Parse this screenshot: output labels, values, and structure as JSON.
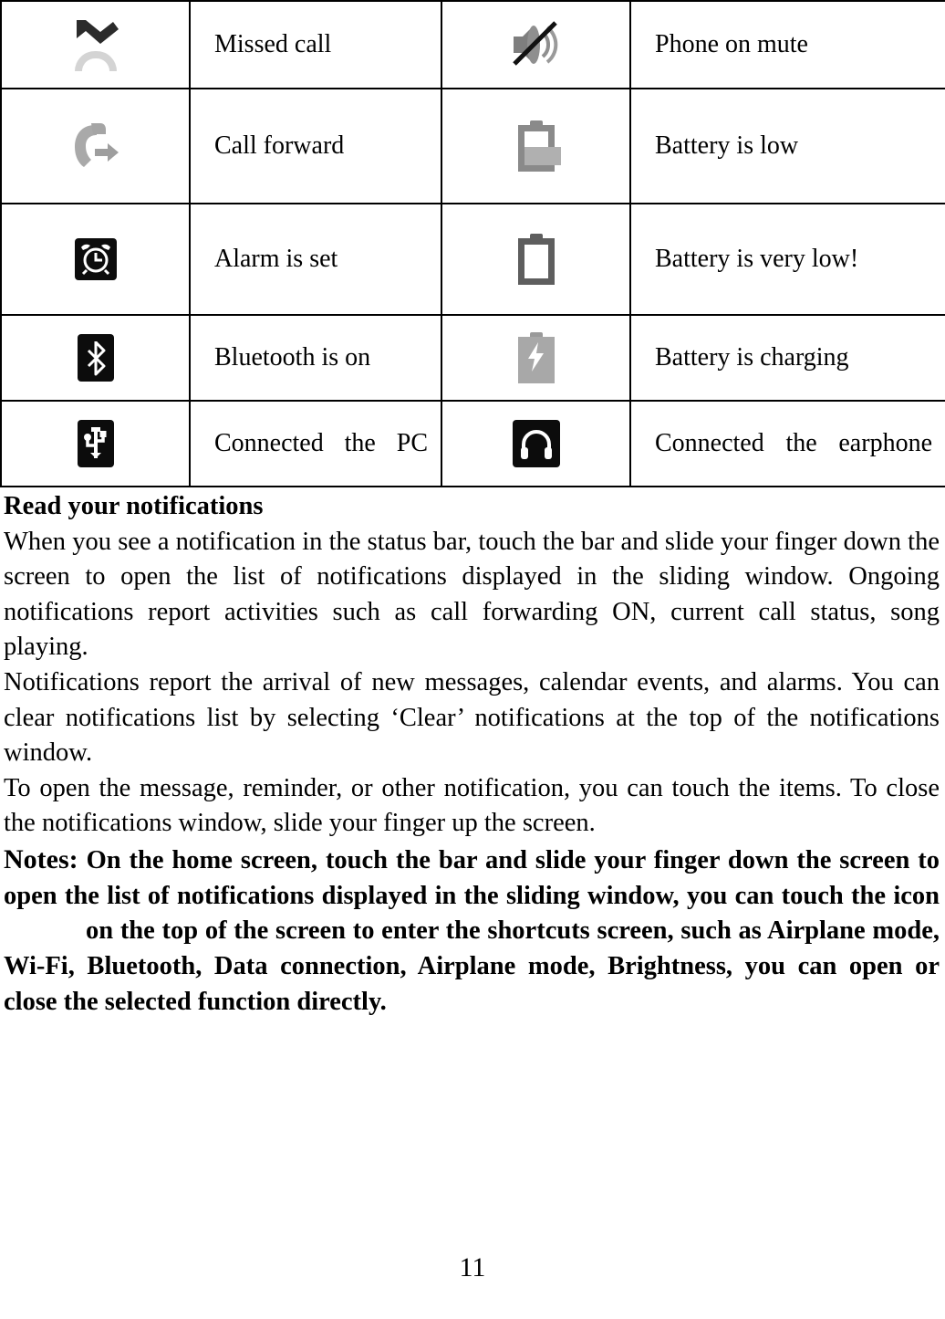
{
  "status_icon_table": {
    "rows": [
      {
        "left_icon": "missed-call-icon",
        "left_label": "Missed call",
        "right_icon": "phone-mute-icon",
        "right_label": "Phone on mute"
      },
      {
        "left_icon": "call-forward-icon",
        "left_label": "Call forward",
        "right_icon": "battery-low-icon",
        "right_label": "Battery is low"
      },
      {
        "left_icon": "alarm-clock-icon",
        "left_label": "Alarm is set",
        "right_icon": "battery-very-low-icon",
        "right_label": "Battery is very low!"
      },
      {
        "left_icon": "bluetooth-icon",
        "left_label": "Bluetooth is on",
        "right_icon": "battery-charging-icon",
        "right_label": "Battery is charging"
      },
      {
        "left_icon": "usb-icon",
        "left_label": "Connected the PC",
        "right_icon": "earphone-icon",
        "right_label": "Connected the earphone"
      }
    ]
  },
  "content": {
    "heading": "Read your notifications",
    "paragraph_1": "When you see a notification in the status bar, touch the bar and slide your finger down the screen to open the list of notifications displayed in the sliding window. Ongoing notifications report activities such as call forwarding ON, current call status, song playing.",
    "paragraph_2": "Notifications report the arrival of new messages, calendar events, and alarms. You can clear notifications list by selecting ‘Clear’ notifications at the top of the notifications window.",
    "paragraph_3": "To open the message, reminder, or other notification, you can touch the items. To close the notifications window, slide your finger up the screen.",
    "notes_label": "Notes:",
    "notes_text_before_icon": "On the home screen, touch the bar and slide your finger down the screen to open the list of notifications displayed in the sliding window, you can touch the icon",
    "notes_text_after_icon": "on the top of the screen to enter the shortcuts screen, such as Airplane mode, Wi-Fi, Bluetooth, Data connection, Airplane mode, Brightness, you can open or close the selected function directly."
  },
  "footer": {
    "page_number": "11"
  }
}
